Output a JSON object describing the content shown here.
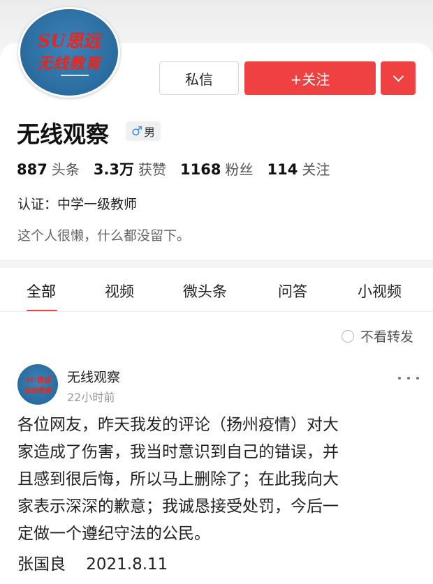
{
  "profile": {
    "avatar_text_line1": "SU思远",
    "avatar_text_line2": "无线教育",
    "name": "无线观察",
    "gender_symbol": "♂",
    "gender_label": "男",
    "certification": "认证：中学一级教师",
    "bio": "这个人很懒，什么都没留下。"
  },
  "actions": {
    "message_label": "私信",
    "follow_label": "+关注"
  },
  "stats": [
    {
      "value": "887",
      "label": "头条"
    },
    {
      "value": "3.3万",
      "label": "获赞"
    },
    {
      "value": "1168",
      "label": "粉丝"
    },
    {
      "value": "114",
      "label": "关注"
    }
  ],
  "tabs": [
    {
      "label": "全部",
      "active": true
    },
    {
      "label": "视频"
    },
    {
      "label": "微头条"
    },
    {
      "label": "问答"
    },
    {
      "label": "小视频"
    }
  ],
  "filter": {
    "label": "不看转发"
  },
  "post": {
    "avatar_text_line1": "SU思远",
    "avatar_text_line2": "无线教育",
    "author": "无线观察",
    "time": "22小时前",
    "body_lines": [
      "各位网友，昨天我发的评论（扬州疫情）对大",
      "家造成了伤害，我当时意识到自己的错误，并",
      "且感到很后悔，所以马上删除了；在此我向大",
      "家表示深深的歉意；我诚恳接受处罚，今后一",
      "定做一个遵纪守法的公民。"
    ],
    "signature": "张国良    2021.8.11"
  },
  "colors": {
    "accent": "#f04142",
    "background": "#f3f3f3",
    "avatar_blue": "#2c6fa3",
    "gender_blue": "#3f8fd6"
  }
}
